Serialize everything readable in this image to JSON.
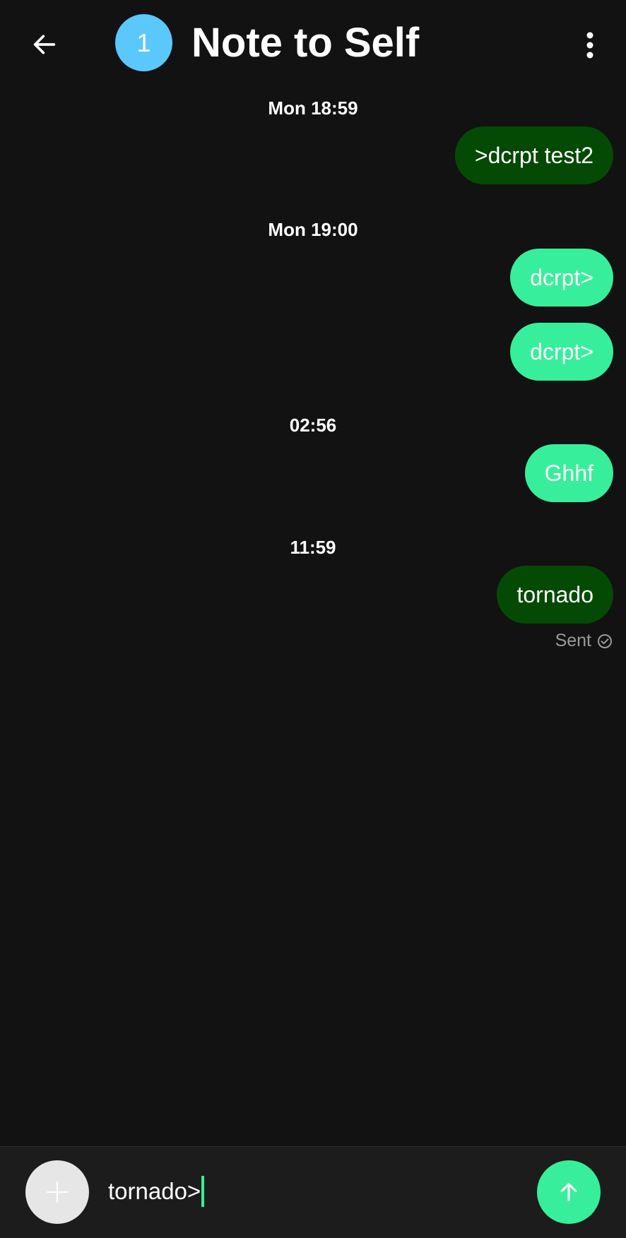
{
  "header": {
    "avatar_text": "1",
    "title": "Note to Self",
    "back_icon": "arrow-left-icon",
    "more_icon": "more-vertical-icon"
  },
  "conversation": {
    "groups": [
      {
        "timestamp": "Mon 18:59",
        "messages": [
          {
            "text": ">dcrpt test2",
            "style": "dark"
          }
        ]
      },
      {
        "timestamp": "Mon 19:00",
        "messages": [
          {
            "text": "dcrpt>",
            "style": "light"
          },
          {
            "text": "dcrpt>",
            "style": "light"
          }
        ]
      },
      {
        "timestamp": "02:56",
        "messages": [
          {
            "text": "Ghhf",
            "style": "light"
          }
        ]
      },
      {
        "timestamp": "11:59",
        "messages": [
          {
            "text": "tornado",
            "style": "dark"
          }
        ]
      }
    ],
    "status": "Sent"
  },
  "composer": {
    "input_value": "tornado>",
    "attach_icon": "plus-icon",
    "send_icon": "arrow-up-icon"
  },
  "colors": {
    "background": "#121212",
    "avatar": "#5ac8fa",
    "bubble_dark": "#044a04",
    "bubble_light": "#37ef9a",
    "accent": "#37ef9a"
  }
}
